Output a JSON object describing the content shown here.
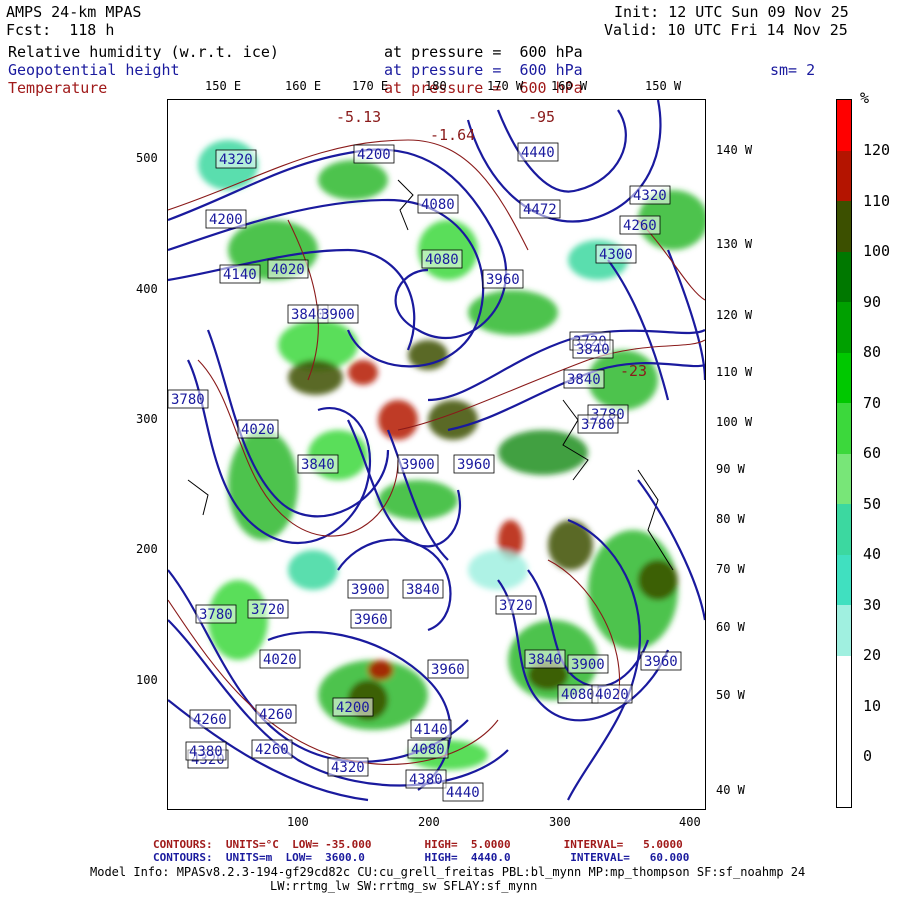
{
  "header": {
    "model": "AMPS 24-km MPAS",
    "fcst": "Fcst:  118 h",
    "init": "Init: 12 UTC Sun 09 Nov 25",
    "valid": "Valid: 10 UTC Fri 14 Nov 25"
  },
  "fields": [
    {
      "name": "Relative humidity (w.r.t. ice)",
      "level": "at pressure =  600 hPa",
      "color": "#000000"
    },
    {
      "name": "Geopotential height",
      "level": "at pressure =  600 hPa",
      "color": "#1a1a9e"
    },
    {
      "name": "Temperature",
      "level": "at pressure =  600 hPa",
      "color": "#a01a1a"
    }
  ],
  "smoothing": "sm= 2",
  "colorbar": {
    "unit": "%",
    "ticks": [
      "120",
      "110",
      "100",
      "90",
      "80",
      "70",
      "60",
      "50",
      "40",
      "30",
      "20",
      "10",
      "0"
    ],
    "colors": [
      "#ff0000",
      "#b41400",
      "#3c5000",
      "#007800",
      "#00a000",
      "#00c800",
      "#3cd83c",
      "#78e678",
      "#3cd8a0",
      "#40e0c0",
      "#a0f0e0",
      "#ffffff",
      "#ffffff",
      "#ffffff"
    ]
  },
  "map": {
    "lon_labels_top": [
      "150 E",
      "160 E",
      "170 E",
      "180",
      "170 W",
      "160 W",
      "150 W"
    ],
    "lat_labels_right": [
      "140 W",
      "130 W",
      "120 W",
      "110 W",
      "100 W",
      "90 W",
      "80 W",
      "70 W",
      "60 W",
      "50 W",
      "40 W"
    ],
    "y_ticks": [
      "500",
      "400",
      "300",
      "200",
      "100"
    ],
    "x_ticks": [
      "100",
      "200",
      "300",
      "400"
    ],
    "height_labels": [
      "4320",
      "4200",
      "4440",
      "4472",
      "4320",
      "4260",
      "4080",
      "4200",
      "4300",
      "4140",
      "4080",
      "3960",
      "4020",
      "3840",
      "3900",
      "3780",
      "4020",
      "3840",
      "3900",
      "3960",
      "3780",
      "3840",
      "3720",
      "3780",
      "3840",
      "3900",
      "3840",
      "3720",
      "3780",
      "3960",
      "3720",
      "3840",
      "3900",
      "3960",
      "4080",
      "4020",
      "4020",
      "4260",
      "4200",
      "3960",
      "4080",
      "4140",
      "4260",
      "4320",
      "4380",
      "4260",
      "4320",
      "4380",
      "4440"
    ],
    "temp_labels": [
      "-5.13",
      "-1.64",
      "-95",
      "-23"
    ]
  },
  "footer": {
    "temp_contours": "CONTOURS:  UNITS=°C  LOW= -35.000        HIGH=  5.0000        INTERVAL=   5.0000",
    "height_contours": "CONTOURS:  UNITS=m  LOW=  3600.0         HIGH=  4440.0         INTERVAL=   60.000",
    "model_info": "Model Info: MPASv8.2.3-194-gf29cd82c CU:cu_grell_freitas PBL:bl_mynn MP:mp_thompson SF:sf_noahmp 24",
    "model_info2": "LW:rrtmg_lw SW:rrtmg_sw SFLAY:sf_mynn"
  }
}
